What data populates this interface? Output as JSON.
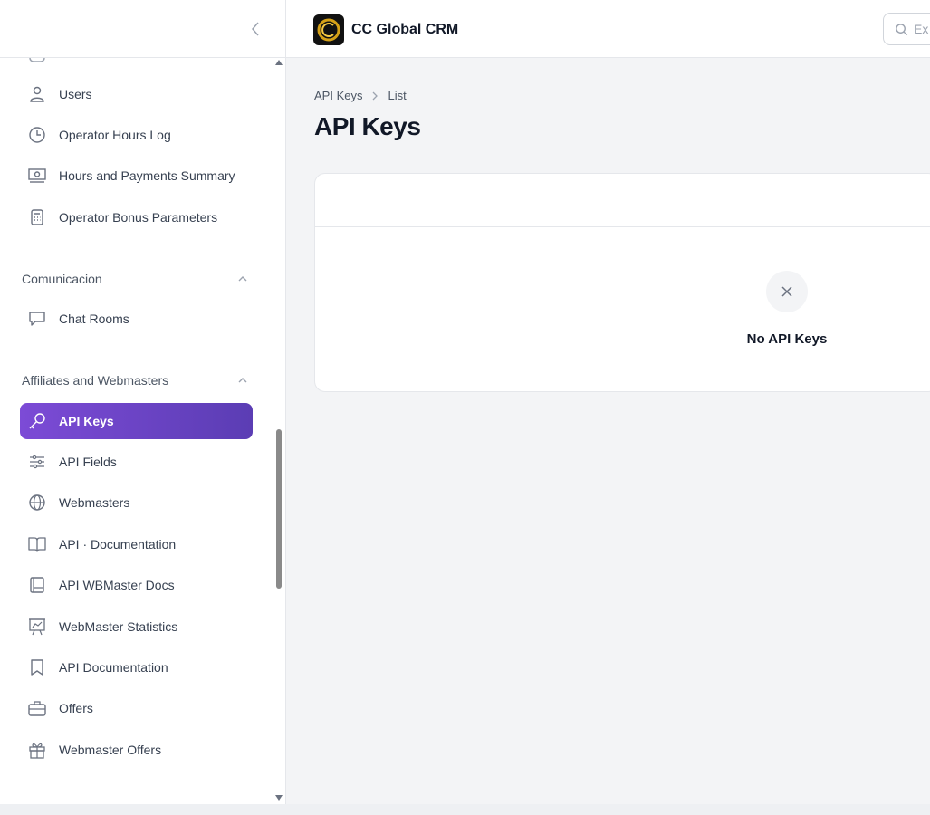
{
  "app": {
    "name": "CC Global CRM"
  },
  "search": {
    "placeholder": "Ex"
  },
  "breadcrumb": {
    "parent": "API Keys",
    "current": "List"
  },
  "page": {
    "title": "API Keys"
  },
  "empty_state": {
    "message": "No API Keys"
  },
  "sidebar": {
    "items_top": [
      {
        "label": "Users",
        "icon": "user-icon"
      },
      {
        "label": "Operator Hours Log",
        "icon": "clock-icon"
      },
      {
        "label": "Hours and Payments Summary",
        "icon": "banknote-icon"
      },
      {
        "label": "Operator Bonus Parameters",
        "icon": "calculator-icon"
      }
    ],
    "group_comunicacion": {
      "label": "Comunicacion"
    },
    "items_comunicacion": [
      {
        "label": "Chat Rooms",
        "icon": "chat-icon"
      }
    ],
    "group_affiliates": {
      "label": "Affiliates and Webmasters"
    },
    "items_affiliates": [
      {
        "label": "API Keys",
        "icon": "key-icon",
        "active": true
      },
      {
        "label": "API Fields",
        "icon": "sliders-icon"
      },
      {
        "label": "Webmasters",
        "icon": "globe-icon"
      },
      {
        "label": "API · Documentation",
        "icon": "book-open-icon"
      },
      {
        "label": "API WBMaster Docs",
        "icon": "book-icon"
      },
      {
        "label": "WebMaster Statistics",
        "icon": "presentation-chart-icon"
      },
      {
        "label": "API Documentation",
        "icon": "bookmark-icon"
      },
      {
        "label": "Offers",
        "icon": "briefcase-icon"
      },
      {
        "label": "Webmaster Offers",
        "icon": "gift-icon"
      }
    ]
  },
  "colors": {
    "accent": "#6b44c9",
    "background": "#f3f4f6"
  }
}
